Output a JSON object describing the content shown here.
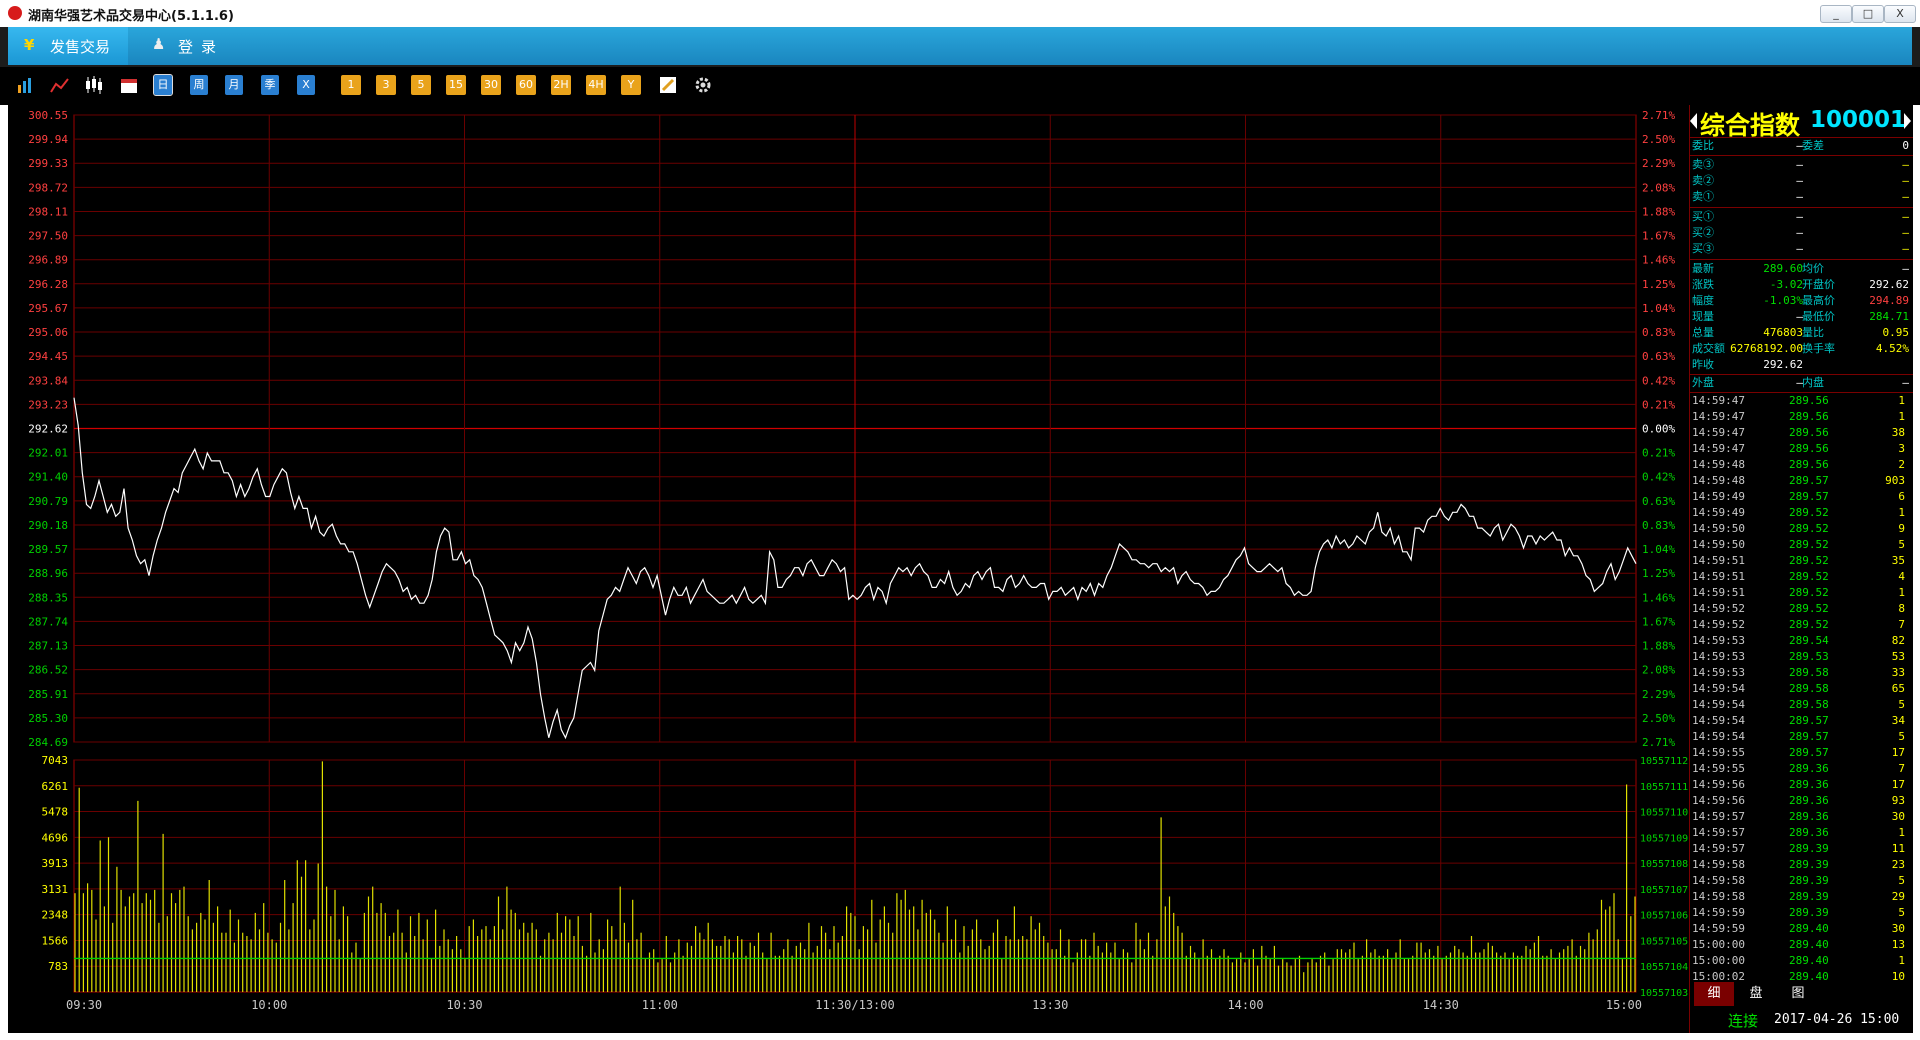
{
  "window": {
    "title": "湖南华强艺术品交易中心(5.1.1.6)",
    "min": "_",
    "max": "□",
    "close": "X"
  },
  "menu": [
    {
      "icon": "¥",
      "label": "发售交易"
    },
    {
      "icon": "♟",
      "label": "登录"
    }
  ],
  "toolbar": {
    "icons": [
      "bar-chart",
      "line-chart",
      "candlestick",
      "calendar"
    ],
    "periods": [
      "日",
      "周",
      "月",
      "季",
      "X"
    ],
    "minutes": [
      "1",
      "3",
      "5",
      "15",
      "30",
      "60",
      "2H",
      "4H",
      "Y"
    ],
    "tools": [
      "pencil",
      "settings"
    ]
  },
  "chart_data": [
    {
      "type": "line",
      "title": "",
      "x_ticks": [
        "09:30",
        "10:00",
        "10:30",
        "11:00",
        "11:30/13:00",
        "13:30",
        "14:00",
        "14:30",
        "15:00"
      ],
      "ylim": [
        284.69,
        300.55
      ],
      "prev_close": 292.62,
      "y_ticks_left": [
        "300.55",
        "299.94",
        "299.33",
        "298.72",
        "298.11",
        "297.50",
        "296.89",
        "296.28",
        "295.67",
        "295.06",
        "294.45",
        "293.84",
        "293.23",
        "292.62",
        "292.01",
        "291.40",
        "290.79",
        "290.18",
        "289.57",
        "288.96",
        "288.35",
        "287.74",
        "287.13",
        "286.52",
        "285.91",
        "285.30",
        "284.69"
      ],
      "y_ticks_right": [
        "2.71%",
        "2.50%",
        "2.29%",
        "2.08%",
        "1.88%",
        "1.67%",
        "1.46%",
        "1.25%",
        "1.04%",
        "0.83%",
        "0.63%",
        "0.42%",
        "0.21%",
        "0.00%",
        "0.21%",
        "0.42%",
        "0.63%",
        "0.83%",
        "1.04%",
        "1.25%",
        "1.46%",
        "1.67%",
        "1.88%",
        "2.08%",
        "2.29%",
        "2.50%",
        "2.71%"
      ],
      "series": [
        {
          "values": [
            293.4,
            292.7,
            291.5,
            290.7,
            290.6,
            290.9,
            291.3,
            290.9,
            290.5,
            290.7,
            290.4,
            290.5,
            291.1,
            290.1,
            289.8,
            289.4,
            289.2,
            289.3,
            288.9,
            289.4,
            289.8,
            290.1,
            290.5,
            290.8,
            291.1,
            291.0,
            291.5,
            291.7,
            291.9,
            292.1,
            291.8,
            291.6,
            292.0,
            291.8,
            291.8,
            291.8,
            291.5,
            291.5,
            291.3,
            290.9,
            291.2,
            290.9,
            291.1,
            291.4,
            291.6,
            291.2,
            290.9,
            290.9,
            291.2,
            291.4,
            291.6,
            291.5,
            291.0,
            290.6,
            290.9,
            290.6,
            290.6,
            290.1,
            290.4,
            290.0,
            289.9,
            290.1,
            290.2,
            289.9,
            289.7,
            289.7,
            289.5,
            289.5,
            289.2,
            288.8,
            288.4,
            288.1,
            288.4,
            288.7,
            289.0,
            289.2,
            289.1,
            289.0,
            288.8,
            288.5,
            288.6,
            288.3,
            288.4,
            288.2,
            288.2,
            288.4,
            288.8,
            289.5,
            289.9,
            290.1,
            290.0,
            289.3,
            289.3,
            289.5,
            289.2,
            289.3,
            288.9,
            288.8,
            288.6,
            288.2,
            287.8,
            287.4,
            287.3,
            287.2,
            287.0,
            286.7,
            287.2,
            287.0,
            287.2,
            287.6,
            287.3,
            286.7,
            285.9,
            285.3,
            284.8,
            285.2,
            285.5,
            285.0,
            284.8,
            285.1,
            285.3,
            285.9,
            286.5,
            286.6,
            286.7,
            286.5,
            287.5,
            287.9,
            288.3,
            288.4,
            288.6,
            288.5,
            288.8,
            289.1,
            288.9,
            288.7,
            289.0,
            289.1,
            288.9,
            288.6,
            288.9,
            288.4,
            287.9,
            288.3,
            288.6,
            288.4,
            288.4,
            288.6,
            288.2,
            288.4,
            288.6,
            288.8,
            288.5,
            288.4,
            288.3,
            288.2,
            288.2,
            288.3,
            288.4,
            288.2,
            288.4,
            288.6,
            288.3,
            288.2,
            288.3,
            288.4,
            288.2,
            289.5,
            289.3,
            288.6,
            288.6,
            288.8,
            288.9,
            289.1,
            289.1,
            288.9,
            289.2,
            289.3,
            289.1,
            288.9,
            288.9,
            289.1,
            289.3,
            289.2,
            289.0,
            289.1,
            288.3,
            288.4,
            288.3,
            288.4,
            288.6,
            288.7,
            288.3,
            288.6,
            288.5,
            288.2,
            288.7,
            288.9,
            289.1,
            289.0,
            289.1,
            288.9,
            289.1,
            289.2,
            289.0,
            288.9,
            288.6,
            288.6,
            288.8,
            288.7,
            289.0,
            288.6,
            288.4,
            288.5,
            288.7,
            288.6,
            288.9,
            289.0,
            288.8,
            289.0,
            289.1,
            288.6,
            288.6,
            288.5,
            288.8,
            288.9,
            288.6,
            288.7,
            288.9,
            288.7,
            288.6,
            288.6,
            288.7,
            288.7,
            288.3,
            288.5,
            288.5,
            288.6,
            288.4,
            288.5,
            288.6,
            288.3,
            288.6,
            288.5,
            288.7,
            288.4,
            288.7,
            288.6,
            288.9,
            289.1,
            289.4,
            289.7,
            289.6,
            289.5,
            289.3,
            289.3,
            289.2,
            289.2,
            289.1,
            289.2,
            289.2,
            289.0,
            289.1,
            289.0,
            289.1,
            288.7,
            288.9,
            289.0,
            288.8,
            288.7,
            288.7,
            288.6,
            288.4,
            288.5,
            288.5,
            288.6,
            288.8,
            288.9,
            289.1,
            289.3,
            289.4,
            289.6,
            289.2,
            289.1,
            289.0,
            289.0,
            289.1,
            289.2,
            289.1,
            289.0,
            289.1,
            288.7,
            288.6,
            288.4,
            288.5,
            288.4,
            288.4,
            288.5,
            289.1,
            289.5,
            289.7,
            289.8,
            289.6,
            289.9,
            289.7,
            289.8,
            289.6,
            289.7,
            289.9,
            289.8,
            289.7,
            290.0,
            290.1,
            290.5,
            290.0,
            289.9,
            290.1,
            289.7,
            289.9,
            289.5,
            289.5,
            289.3,
            290.1,
            290.1,
            290.0,
            290.3,
            290.4,
            290.4,
            290.6,
            290.4,
            290.3,
            290.5,
            290.5,
            290.7,
            290.6,
            290.4,
            290.4,
            290.1,
            290.1,
            290.0,
            289.9,
            290.1,
            290.2,
            289.8,
            290.0,
            290.2,
            290.1,
            289.9,
            289.6,
            289.9,
            289.9,
            289.7,
            289.9,
            289.8,
            289.9,
            290.0,
            289.8,
            289.8,
            289.4,
            289.6,
            289.4,
            289.4,
            289.2,
            288.9,
            288.8,
            288.5,
            288.6,
            288.7,
            289.0,
            289.2,
            288.8,
            289.0,
            289.3,
            289.6,
            289.4,
            289.2
          ]
        }
      ]
    },
    {
      "type": "bar",
      "title": "",
      "x_ticks": [
        "09:30",
        "10:00",
        "10:30",
        "11:00",
        "11:30/13:00",
        "13:30",
        "14:00",
        "14:30",
        "15:00"
      ],
      "ylim": [
        0,
        7043
      ],
      "y_ticks_left": [
        "7043",
        "6261",
        "5478",
        "4696",
        "3913",
        "3131",
        "2348",
        "1566",
        "783"
      ],
      "y_ticks_right": [
        "10557112",
        "10557111",
        "10557110",
        "10557109",
        "10557108",
        "10557107",
        "10557106",
        "10557105",
        "10557104",
        "10557103"
      ],
      "values": [
        3000,
        6200,
        3000,
        3300,
        3100,
        2200,
        4600,
        2600,
        4700,
        2100,
        3800,
        3100,
        2600,
        2900,
        3000,
        5800,
        2700,
        3000,
        2800,
        3100,
        2100,
        4800,
        2300,
        3000,
        2700,
        3100,
        3200,
        2300,
        1900,
        2100,
        2400,
        2200,
        3400,
        2100,
        2600,
        1800,
        1800,
        2500,
        1500,
        2200,
        1800,
        1700,
        1600,
        2400,
        1900,
        2700,
        1800,
        1600,
        1500,
        2100,
        3400,
        1900,
        2700,
        4000,
        3500,
        4000,
        1900,
        2200,
        3900,
        7000,
        3200,
        2300,
        3100,
        1600,
        2600,
        2300,
        1200,
        1500,
        1000,
        2400,
        2900,
        3200,
        2400,
        2700,
        2400,
        1700,
        1800,
        2500,
        1800,
        1200,
        2300,
        1700,
        2400,
        1600,
        2200,
        1000,
        2500,
        1400,
        1900,
        1600,
        1300,
        1700,
        1300,
        1000,
        2000,
        2200,
        1700,
        1900,
        2000,
        1600,
        2000,
        2900,
        1900,
        3200,
        2500,
        2400,
        1900,
        2100,
        1800,
        2100,
        1900,
        1100,
        1600,
        1800,
        1600,
        2400,
        1800,
        2300,
        2200,
        1700,
        2300,
        1400,
        1100,
        2400,
        1200,
        1600,
        1300,
        2200,
        2000,
        1600,
        3200,
        2100,
        1500,
        2800,
        1600,
        1800,
        1000,
        1200,
        1300,
        900,
        1000,
        1700,
        900,
        1200,
        1600,
        1100,
        1500,
        1400,
        2000,
        1800,
        1600,
        2100,
        1600,
        1400,
        1400,
        1700,
        1600,
        1200,
        1700,
        1600,
        1100,
        1500,
        1400,
        1800,
        1200,
        1000,
        1800,
        1100,
        1100,
        1300,
        1600,
        1100,
        1400,
        1500,
        1300,
        2100,
        1200,
        1400,
        2000,
        1800,
        1300,
        2000,
        1500,
        1700,
        2600,
        2400,
        2300,
        1300,
        2000,
        1900,
        2800,
        1500,
        2200,
        2600,
        2100,
        1800,
        3000,
        2800,
        3100,
        2500,
        2600,
        1900,
        2800,
        2400,
        2500,
        2200,
        1800,
        1500,
        2600,
        1600,
        2200,
        1200,
        2000,
        1400,
        1900,
        2200,
        1600,
        1300,
        1400,
        1800,
        2200,
        1000,
        1700,
        1600,
        2600,
        1600,
        1700,
        1600,
        2300,
        1900,
        2100,
        1700,
        1500,
        1300,
        1300,
        1900,
        1100,
        1600,
        900,
        1200,
        1600,
        1600,
        1100,
        1800,
        1400,
        1200,
        1500,
        1200,
        1500,
        1000,
        1300,
        1200,
        900,
        2100,
        1600,
        1300,
        1800,
        1100,
        1600,
        5300,
        2600,
        2900,
        2400,
        2000,
        1800,
        1100,
        1400,
        1200,
        1000,
        1600,
        1100,
        1300,
        1000,
        1100,
        1300,
        1100,
        900,
        1000,
        1200,
        900,
        1000,
        1300,
        800,
        1400,
        1100,
        1000,
        1400,
        800,
        1000,
        900,
        800,
        1000,
        1100,
        600,
        900,
        1000,
        900,
        1100,
        1200,
        800,
        1000,
        1300,
        1300,
        1200,
        1300,
        1500,
        1000,
        1100,
        1600,
        1200,
        1300,
        1100,
        1100,
        1300,
        1000,
        1200,
        1600,
        1000,
        1000,
        1100,
        1500,
        1500,
        1200,
        1300,
        1100,
        1400,
        1000,
        1100,
        1200,
        1400,
        1300,
        1200,
        1100,
        1700,
        1200,
        1200,
        1300,
        1500,
        1400,
        1200,
        1100,
        1200,
        1000,
        1200,
        1100,
        1100,
        1400,
        1300,
        1500,
        1700,
        1100,
        1100,
        1300,
        1000,
        1200,
        1300,
        1400,
        1600,
        1100,
        1400,
        1300,
        1800,
        1600,
        1900,
        2800,
        2500,
        2600,
        3000,
        1600,
        1000,
        6300,
        2300,
        2900
      ]
    }
  ],
  "panel": {
    "name": "综合指数",
    "code": "100001",
    "weibi": {
      "label": "委比",
      "value": "—",
      "label2": "委差",
      "value2": "0"
    },
    "sell": [
      {
        "label": "卖③",
        "price": "—",
        "vol": "—"
      },
      {
        "label": "卖②",
        "price": "—",
        "vol": "—"
      },
      {
        "label": "卖①",
        "price": "—",
        "vol": "—"
      }
    ],
    "buy": [
      {
        "label": "买①",
        "price": "—",
        "vol": "—"
      },
      {
        "label": "买②",
        "price": "—",
        "vol": "—"
      },
      {
        "label": "买③",
        "price": "—",
        "vol": "—"
      }
    ],
    "stats": [
      {
        "l1": "最新",
        "v1": "289.60",
        "c1": "#00e000",
        "l2": "均价",
        "v2": "—",
        "c2": "#ffffff"
      },
      {
        "l1": "涨跌",
        "v1": "-3.02",
        "c1": "#00e000",
        "l2": "开盘价",
        "v2": "292.62",
        "c2": "#ffffff"
      },
      {
        "l1": "幅度",
        "v1": "-1.03%",
        "c1": "#00e000",
        "l2": "最高价",
        "v2": "294.89",
        "c2": "#ff4040"
      },
      {
        "l1": "现量",
        "v1": "—",
        "c1": "#ffffff",
        "l2": "最低价",
        "v2": "284.71",
        "c2": "#00e000"
      },
      {
        "l1": "总量",
        "v1": "476803",
        "c1": "#ffff00",
        "l2": "量比",
        "v2": "0.95",
        "c2": "#ffff00"
      },
      {
        "l1": "成交额",
        "v1": "62768192.00",
        "c1": "#ffff00",
        "l2": "换手率",
        "v2": "4.52%",
        "c2": "#ffff00"
      },
      {
        "l1": "昨收",
        "v1": "292.62",
        "c1": "#ffffff",
        "l2": "",
        "v2": "",
        "c2": "#ffffff"
      }
    ],
    "outer": {
      "label": "外盘",
      "value": "—",
      "label2": "内盘",
      "value2": "—"
    },
    "ticks": [
      [
        "14:59:47",
        "289.56",
        "1"
      ],
      [
        "14:59:47",
        "289.56",
        "1"
      ],
      [
        "14:59:47",
        "289.56",
        "38"
      ],
      [
        "14:59:47",
        "289.56",
        "3"
      ],
      [
        "14:59:48",
        "289.56",
        "2"
      ],
      [
        "14:59:48",
        "289.57",
        "903"
      ],
      [
        "14:59:49",
        "289.57",
        "6"
      ],
      [
        "14:59:49",
        "289.52",
        "1"
      ],
      [
        "14:59:50",
        "289.52",
        "9"
      ],
      [
        "14:59:50",
        "289.52",
        "5"
      ],
      [
        "14:59:51",
        "289.52",
        "35"
      ],
      [
        "14:59:51",
        "289.52",
        "4"
      ],
      [
        "14:59:51",
        "289.52",
        "1"
      ],
      [
        "14:59:52",
        "289.52",
        "8"
      ],
      [
        "14:59:52",
        "289.52",
        "7"
      ],
      [
        "14:59:53",
        "289.54",
        "82"
      ],
      [
        "14:59:53",
        "289.53",
        "53"
      ],
      [
        "14:59:53",
        "289.58",
        "33"
      ],
      [
        "14:59:54",
        "289.58",
        "65"
      ],
      [
        "14:59:54",
        "289.58",
        "5"
      ],
      [
        "14:59:54",
        "289.57",
        "34"
      ],
      [
        "14:59:54",
        "289.57",
        "5"
      ],
      [
        "14:59:55",
        "289.57",
        "17"
      ],
      [
        "14:59:55",
        "289.36",
        "7"
      ],
      [
        "14:59:56",
        "289.36",
        "17"
      ],
      [
        "14:59:56",
        "289.36",
        "93"
      ],
      [
        "14:59:57",
        "289.36",
        "30"
      ],
      [
        "14:59:57",
        "289.36",
        "1"
      ],
      [
        "14:59:57",
        "289.39",
        "11"
      ],
      [
        "14:59:58",
        "289.39",
        "23"
      ],
      [
        "14:59:58",
        "289.39",
        "5"
      ],
      [
        "14:59:58",
        "289.39",
        "29"
      ],
      [
        "14:59:59",
        "289.39",
        "5"
      ],
      [
        "14:59:59",
        "289.40",
        "30"
      ],
      [
        "15:00:00",
        "289.40",
        "13"
      ],
      [
        "15:00:00",
        "289.40",
        "1"
      ],
      [
        "15:00:02",
        "289.40",
        "10"
      ]
    ],
    "tabs": [
      "细",
      "盘",
      "图"
    ],
    "status": "连接",
    "datetime": "2017-04-26 15:00"
  }
}
